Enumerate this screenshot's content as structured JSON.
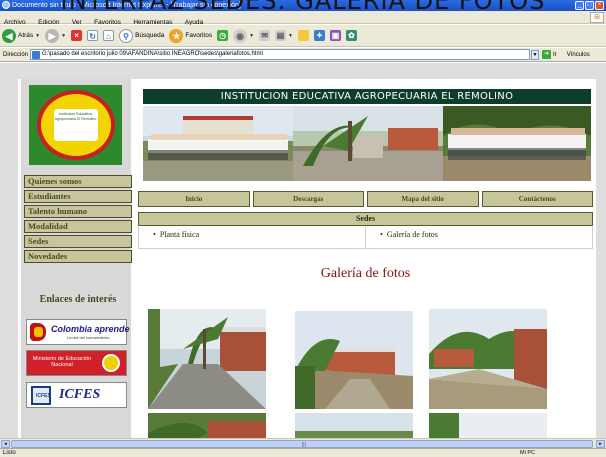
{
  "caption": "INTERFAZ SEDES: GALERIA DE FOTOS",
  "window": {
    "title": "Documento sin título - Microsoft Internet Explorer - [Trabajar sin conexión]",
    "buttons": [
      "_",
      "□",
      "×"
    ]
  },
  "menu": [
    "Archivo",
    "Edición",
    "Ver",
    "Favoritos",
    "Herramientas",
    "Ayuda"
  ],
  "toolbar": {
    "back_label": "Atrás",
    "search_label": "Búsqueda",
    "favorites_label": "Favoritos"
  },
  "address": {
    "label": "Dirección",
    "value": "G:\\pasado del escritorio julio 09\\AFANDINA\\sitio INEAGRO\\sedes\\galeriafotos.html",
    "go_label": "Ir",
    "links_label": "Vínculos"
  },
  "site": {
    "title": "INSTITUCION EDUCATIVA AGROPECUARIA EL REMOLINO",
    "logo_text": "Institución Educativa Agropecuaria El Remolino"
  },
  "sidebar": {
    "items": [
      "Quienes somos",
      "Estudiantes",
      "Talento humano",
      "Modalidad",
      "Sedes",
      "Novedades"
    ],
    "links_title": "Enlaces de interés",
    "colombia_aprende": "Colombia aprende",
    "colombia_sub": "La red del conocimiento",
    "mineducacion": "Ministerio de Educación Nacional",
    "icfes": "ICFES",
    "icfes_small": "ICFES"
  },
  "topnav": [
    "Inicio",
    "Descargas",
    "Mapa del sitio",
    "Contáctenos"
  ],
  "sedes": {
    "heading": "Sedes",
    "links": [
      "Planta física",
      "Galería de fotos"
    ]
  },
  "gallery": {
    "title": "Galería de fotos"
  },
  "status": {
    "text": "Listo",
    "zone": "Mi PC"
  }
}
